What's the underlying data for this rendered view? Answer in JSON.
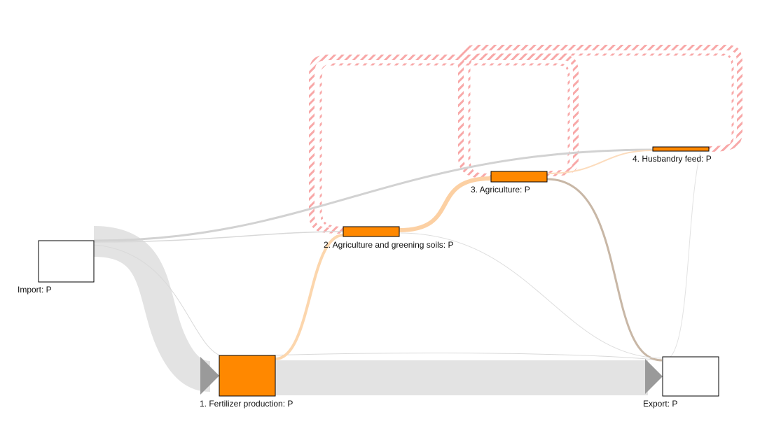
{
  "diagram": {
    "type": "sankey",
    "colors": {
      "flow_main": "#e3e3e3",
      "flow_thin": "#cfcfcf",
      "flow_orange": "#fcd6ad",
      "flow_brown": "#c8b7a6",
      "loop_stripe": "#f79a9a",
      "node_fill": "#ff8800",
      "external_fill": "#ffffff",
      "arrow": "#9a9a9a"
    },
    "nodes": {
      "import": {
        "label": "Import: P"
      },
      "fertilizer": {
        "label": "1. Fertilizer production: P"
      },
      "agri_soils": {
        "label": "2. Agriculture and greening soils: P"
      },
      "agriculture": {
        "label": "3. Agriculture: P"
      },
      "husbandry": {
        "label": "4. Husbandry feed: P"
      },
      "export": {
        "label": "Export: P"
      }
    }
  }
}
